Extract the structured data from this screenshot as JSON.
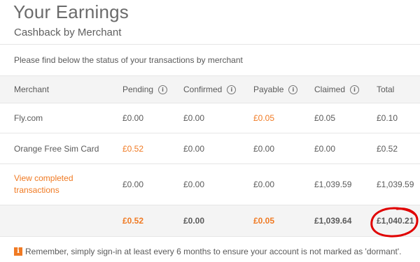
{
  "header": {
    "title": "Your Earnings",
    "subtitle": "Cashback by Merchant"
  },
  "intro_text": "Please find below the status of your transactions by merchant",
  "table": {
    "columns": {
      "merchant": "Merchant",
      "pending": "Pending",
      "confirmed": "Confirmed",
      "payable": "Payable",
      "claimed": "Claimed",
      "total": "Total"
    },
    "rows": [
      {
        "merchant": "Fly.com",
        "pending": "£0.00",
        "confirmed": "£0.00",
        "payable": "£0.05",
        "claimed": "£0.05",
        "total": "£0.10"
      },
      {
        "merchant": "Orange Free Sim Card",
        "pending": "£0.52",
        "confirmed": "£0.00",
        "payable": "£0.00",
        "claimed": "£0.00",
        "total": "£0.52"
      },
      {
        "merchant_link_line1": "View completed",
        "merchant_link_line2": "transactions",
        "pending": "£0.00",
        "confirmed": "£0.00",
        "payable": "£0.00",
        "claimed": "£1,039.59",
        "total": "£1,039.59"
      }
    ],
    "totals": {
      "pending": "£0.52",
      "confirmed": "£0.00",
      "payable": "£0.05",
      "claimed": "£1,039.64",
      "total": "£1,040.21"
    }
  },
  "notice": {
    "icon": "i",
    "text": "Remember, simply sign-in at least every 6 months to ensure your account is not marked as 'dormant'."
  },
  "colors": {
    "accent": "#f07a23",
    "highlight_circle": "#e00000"
  }
}
